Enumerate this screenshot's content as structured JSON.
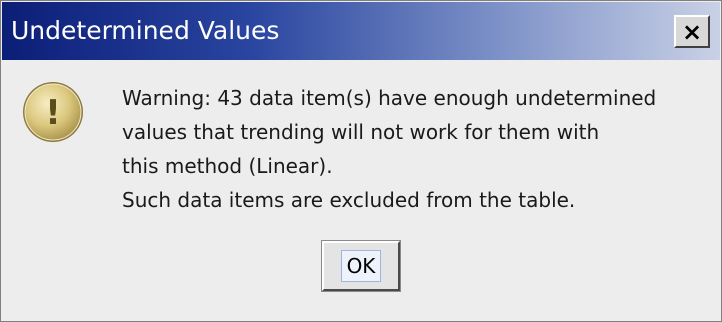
{
  "window": {
    "title": "Undetermined Values",
    "close_label": "×"
  },
  "icon": {
    "name": "warning-icon",
    "glyph": "!",
    "color": "#d4c27a"
  },
  "message": {
    "lines": [
      "Warning: 43 data item(s) have enough undetermined",
      "values that trending will not work for them with",
      "this method (Linear).",
      "Such data items are excluded from the table."
    ]
  },
  "buttons": {
    "ok_label": "OK"
  },
  "colors": {
    "titlebar_start": "#0b1e78",
    "titlebar_end": "#c9d1e6",
    "dialog_background": "#ededed"
  }
}
